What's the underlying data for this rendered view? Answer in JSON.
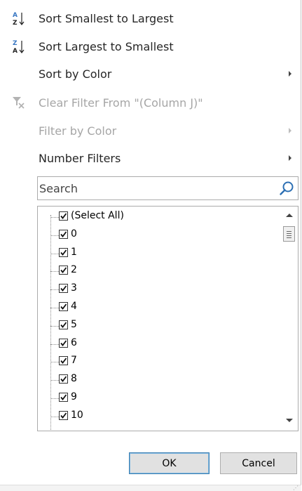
{
  "menu": {
    "sort_asc": "Sort Smallest to Largest",
    "sort_desc": "Sort Largest to Smallest",
    "sort_by_color": "Sort by Color",
    "clear_filter": "Clear Filter From \"(Column J)\"",
    "filter_by_color": "Filter by Color",
    "number_filters": "Number Filters"
  },
  "search": {
    "placeholder": "Search"
  },
  "list": {
    "items": [
      "(Select All)",
      "0",
      "1",
      "2",
      "3",
      "4",
      "5",
      "6",
      "7",
      "8",
      "9",
      "10"
    ],
    "checked": [
      true,
      true,
      true,
      true,
      true,
      true,
      true,
      true,
      true,
      true,
      true,
      true
    ]
  },
  "buttons": {
    "ok": "OK",
    "cancel": "Cancel"
  },
  "colors": {
    "icon_blue": "#3a78c3",
    "icon_black": "#222222",
    "disabled": "#a6a6a6"
  }
}
